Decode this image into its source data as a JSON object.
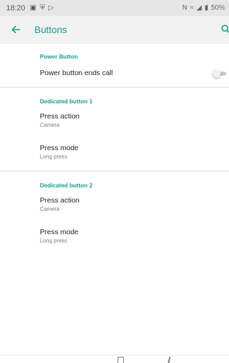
{
  "status_bar": {
    "time": "18:20",
    "battery": "50%"
  },
  "app_bar": {
    "title": "Buttons"
  },
  "sections": [
    {
      "header": "Power Button",
      "items": [
        {
          "title": "Power button ends call",
          "toggle": false
        }
      ]
    },
    {
      "header": "Dedicated button 1",
      "items": [
        {
          "title": "Press action",
          "summary": "Camera"
        },
        {
          "title": "Press mode",
          "summary": "Long press"
        }
      ]
    },
    {
      "header": "Dedicated button 2",
      "items": [
        {
          "title": "Press action",
          "summary": "Camera"
        },
        {
          "title": "Press mode",
          "summary": "Long press"
        }
      ]
    }
  ],
  "colors": {
    "accent": "#149c8f",
    "status_bar_bg": "#e6e6e6",
    "app_bar_bg": "#f2f2f2"
  },
  "icons": [
    "back-arrow-icon",
    "search-icon",
    "image-icon",
    "shield-icon",
    "play-store-icon",
    "nfc-icon",
    "wifi-icon",
    "signal-icon",
    "battery-icon",
    "recents-icon",
    "home-icon"
  ]
}
